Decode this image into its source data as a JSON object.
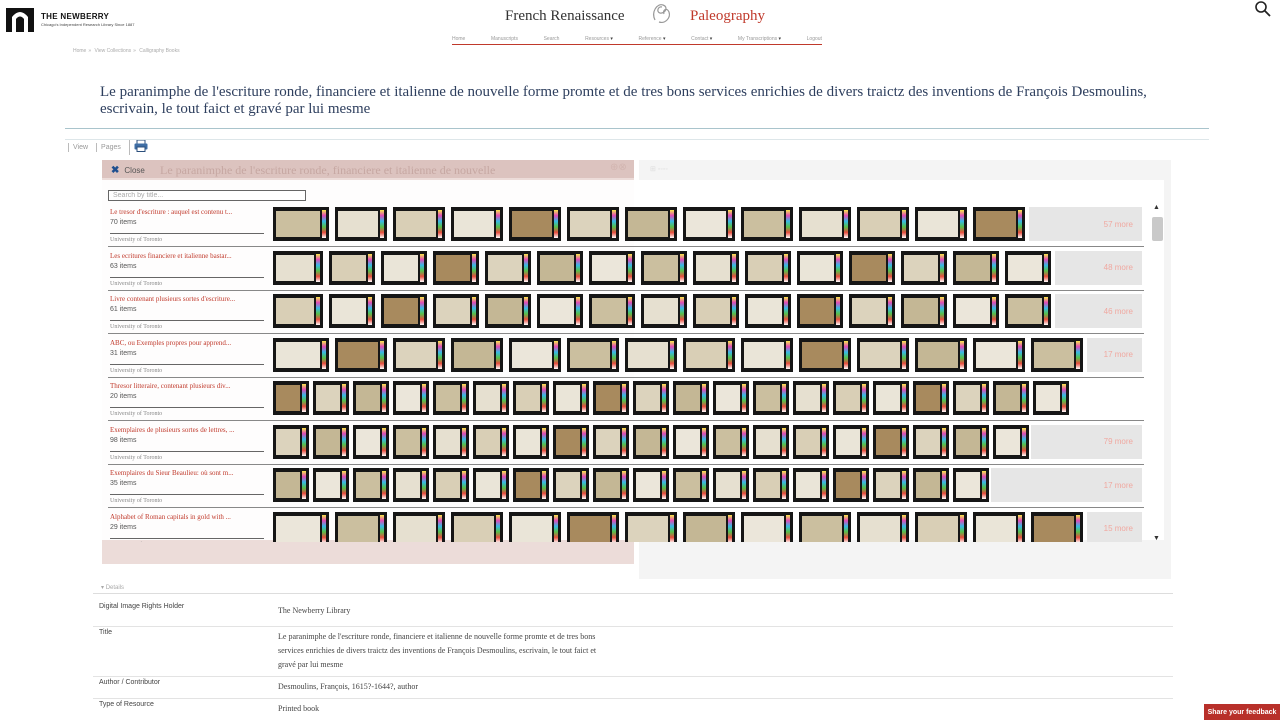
{
  "header": {
    "logo_name": "THE NEWBERRY",
    "logo_tagline": "Chicago's Independent Research Library Since 1887",
    "site_title_left": "French Renaissance",
    "site_title_right": "Paleography"
  },
  "nav": {
    "items": [
      "Home",
      "Manuscripts",
      "Search",
      "Resources",
      "Reference",
      "Contact",
      "My Transcriptions",
      "Logout"
    ]
  },
  "breadcrumb": [
    "Home",
    "View Collections",
    "Calligraphy Books"
  ],
  "page_title": "Le paranimphe de l'escriture ronde, financiere et italienne de nouvelle forme promte et de tres bons services enrichies de divers traictz des inventions de François Desmoulins, escrivain, le tout faict et gravé par lui mesme",
  "toolbar": {
    "view": "View",
    "pages": "Pages"
  },
  "viewer": {
    "ghost_title": "Le paranimphe de l'escriture ronde, financiere et italienne de nouvelle"
  },
  "overlay": {
    "close_label": "Close",
    "search_placeholder": "Search by title...",
    "collections": [
      {
        "title": "Le tresor d'escriture : auquel est contenu t...",
        "count": "70 items",
        "source": "University of Toronto",
        "thumbs": 13,
        "more": "57 more"
      },
      {
        "title": "Les ecritures financiere et italienne bastar...",
        "count": "63 items",
        "source": "University of Toronto",
        "thumbs": 15,
        "more": "48 more"
      },
      {
        "title": "Livre contenant plusieurs sortes d'escriture...",
        "count": "61 items",
        "source": "University of Toronto",
        "thumbs": 15,
        "more": "46 more"
      },
      {
        "title": "ABC, ou Exemples propres pour apprend...",
        "count": "31 items",
        "source": "University of Toronto",
        "thumbs": 14,
        "more": "17 more"
      },
      {
        "title": "Thresor litteraire, contenant plusieurs div...",
        "count": "20 items",
        "source": "University of Toronto",
        "thumbs": 20,
        "more": ""
      },
      {
        "title": "Exemplaires de plusieurs sortes de lettres, ...",
        "count": "98 items",
        "source": "University of Toronto",
        "thumbs": 19,
        "more": "79 more"
      },
      {
        "title": "Exemplaires du Sieur Beaulieu: où sont m...",
        "count": "35 items",
        "source": "University of Toronto",
        "thumbs": 18,
        "more": "17 more"
      },
      {
        "title": "Alphabet of Roman capitals in gold with ...",
        "count": "29 items",
        "source": "University of Toronto",
        "thumbs": 14,
        "more": "15 more"
      }
    ]
  },
  "details": {
    "toggle_label": "Details",
    "rows": [
      {
        "label": "Digital Image Rights Holder",
        "value": "The Newberry Library"
      },
      {
        "label": "Title",
        "value": "Le paranimphe de l'escriture ronde, financiere et italienne de nouvelle forme promte et de tres bons services enrichies de divers traictz des inventions de François Desmoulins, escrivain, le tout faict et gravé par lui mesme"
      },
      {
        "label": "Author / Contributor",
        "value": "Desmoulins, François, 1615?-1644?, author"
      },
      {
        "label": "Type of Resource",
        "value": "Printed book"
      }
    ]
  },
  "feedback_label": "Share your feedback",
  "colors": {
    "accent_red": "#c0392b",
    "title_blue": "#2e3f5e",
    "close_blue": "#1f4f8f"
  }
}
